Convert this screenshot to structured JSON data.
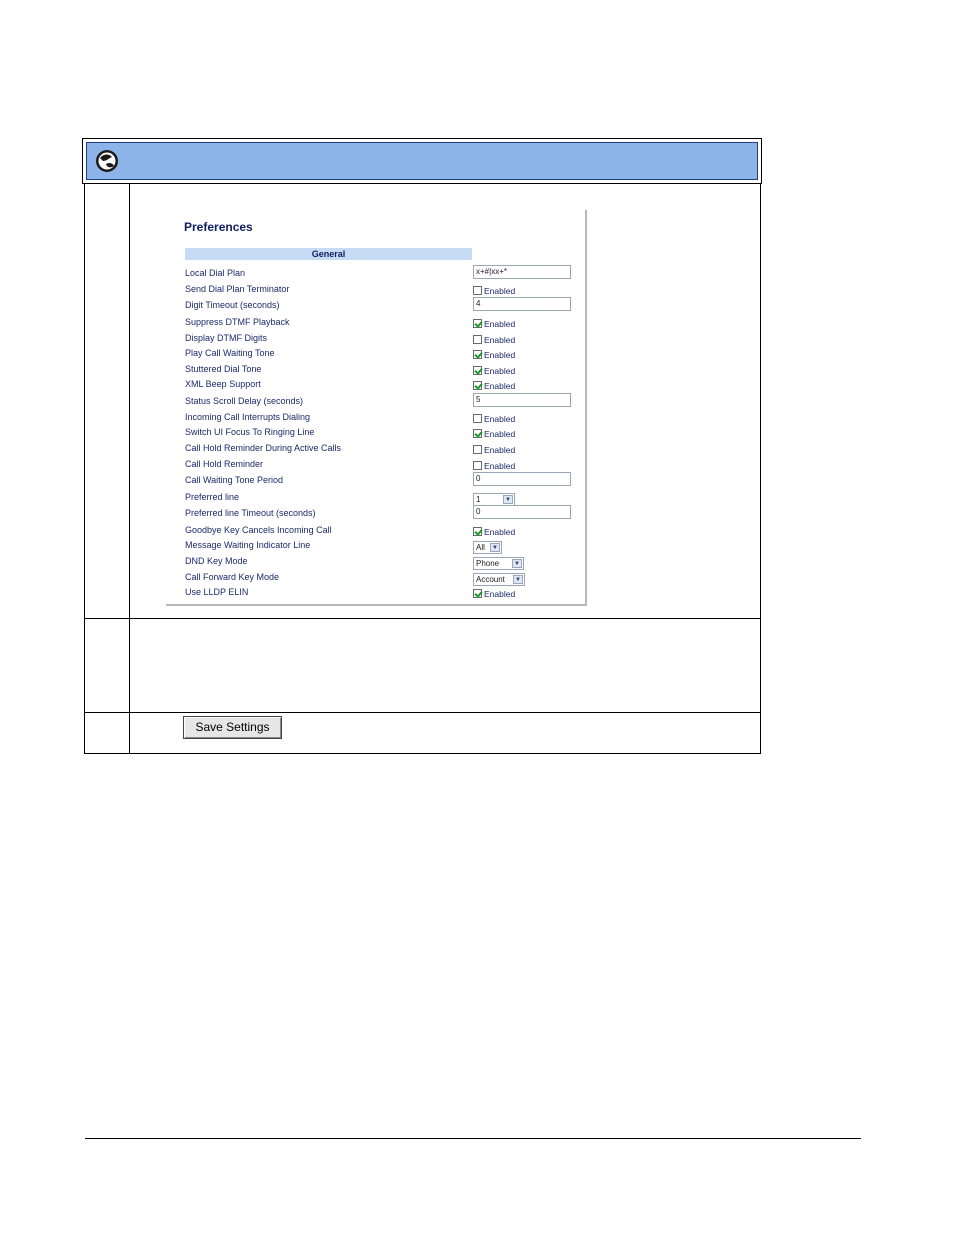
{
  "panel": {
    "title": "Preferences",
    "section": "General",
    "enabled_label": "Enabled"
  },
  "rows": [
    {
      "label": "Local Dial Plan",
      "type": "text",
      "value": "x+#|xx+*"
    },
    {
      "label": "Send Dial Plan Terminator",
      "type": "checkbox",
      "checked": false
    },
    {
      "label": "Digit Timeout (seconds)",
      "type": "text",
      "value": "4"
    },
    {
      "label": "Suppress DTMF Playback",
      "type": "checkbox",
      "checked": true
    },
    {
      "label": "Display DTMF Digits",
      "type": "checkbox",
      "checked": false
    },
    {
      "label": "Play Call Waiting Tone",
      "type": "checkbox",
      "checked": true
    },
    {
      "label": "Stuttered Dial Tone",
      "type": "checkbox",
      "checked": true
    },
    {
      "label": "XML Beep Support",
      "type": "checkbox",
      "checked": true
    },
    {
      "label": "Status Scroll Delay (seconds)",
      "type": "text",
      "value": "5"
    },
    {
      "label": "Incoming Call Interrupts Dialing",
      "type": "checkbox",
      "checked": false
    },
    {
      "label": "Switch UI Focus To Ringing Line",
      "type": "checkbox",
      "checked": true
    },
    {
      "label": "Call Hold Reminder During Active Calls",
      "type": "checkbox",
      "checked": false
    },
    {
      "label": "Call Hold Reminder",
      "type": "checkbox",
      "checked": false
    },
    {
      "label": "Call Waiting Tone Period",
      "type": "text",
      "value": "0"
    },
    {
      "label": "Preferred line",
      "type": "select",
      "value": "1"
    },
    {
      "label": "Preferred line Timeout (seconds)",
      "type": "text",
      "value": "0"
    },
    {
      "label": "Goodbye Key Cancels Incoming Call",
      "type": "checkbox",
      "checked": true
    },
    {
      "label": "Message Waiting Indicator Line",
      "type": "select",
      "value": "All"
    },
    {
      "label": "DND Key Mode",
      "type": "select",
      "value": "Phone"
    },
    {
      "label": "Call Forward Key Mode",
      "type": "select",
      "value": "Account"
    },
    {
      "label": "Use LLDP ELIN",
      "type": "checkbox",
      "checked": true
    }
  ],
  "buttons": {
    "save": "Save Settings"
  },
  "colors": {
    "header_bar": "#8db4e8",
    "section_bar": "#c6dcf5",
    "label_text": "#1b2a6b"
  },
  "icons": {
    "header": "globe-icon"
  }
}
